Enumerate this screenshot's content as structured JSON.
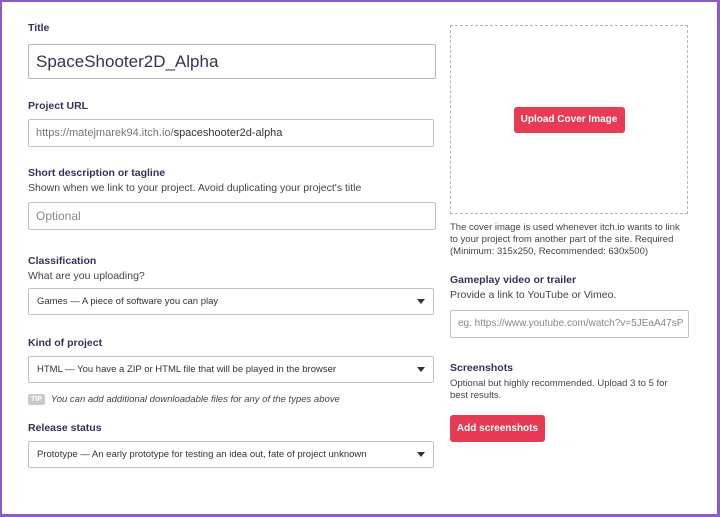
{
  "title_field": {
    "label": "Title",
    "value": "SpaceShooter2D_Alpha"
  },
  "project_url": {
    "label": "Project URL",
    "prefix": "https://matejmarek94.itch.io/",
    "slug": "spaceshooter2d-alpha"
  },
  "short_description": {
    "label": "Short description or tagline",
    "help": "Shown when we link to your project. Avoid duplicating your project's title",
    "placeholder": "Optional"
  },
  "classification": {
    "label": "Classification",
    "help": "What are you uploading?",
    "selected": "Games — A piece of software you can play"
  },
  "kind_of_project": {
    "label": "Kind of project",
    "selected": "HTML — You have a ZIP or HTML file that will be played in the browser"
  },
  "tip": {
    "badge": "TIP",
    "text": "You can add additional downloadable files for any of the types above"
  },
  "release_status": {
    "label": "Release status",
    "selected": "Prototype — An early prototype for testing an idea out, fate of project unknown"
  },
  "cover_image": {
    "button_label": "Upload Cover Image",
    "help_lines": [
      "The cover image is used whenever itch.io wants to link",
      "to your project from another part of the site. Required",
      "(Minimum: 315x250, Recommended: 630x500)"
    ]
  },
  "gameplay_video": {
    "label": "Gameplay video or trailer",
    "help": "Provide a link to YouTube or Vimeo.",
    "placeholder": "eg. https://www.youtube.com/watch?v=5JEaA47sP"
  },
  "screenshots": {
    "label": "Screenshots",
    "help_lines": [
      "Optional but highly recommended. Upload 3 to 5 for",
      "best results."
    ],
    "button_label": "Add screenshots"
  },
  "colors": {
    "accent": "#e63a55",
    "label_text": "#3a2f5b",
    "frame": "#8a5cc8"
  }
}
